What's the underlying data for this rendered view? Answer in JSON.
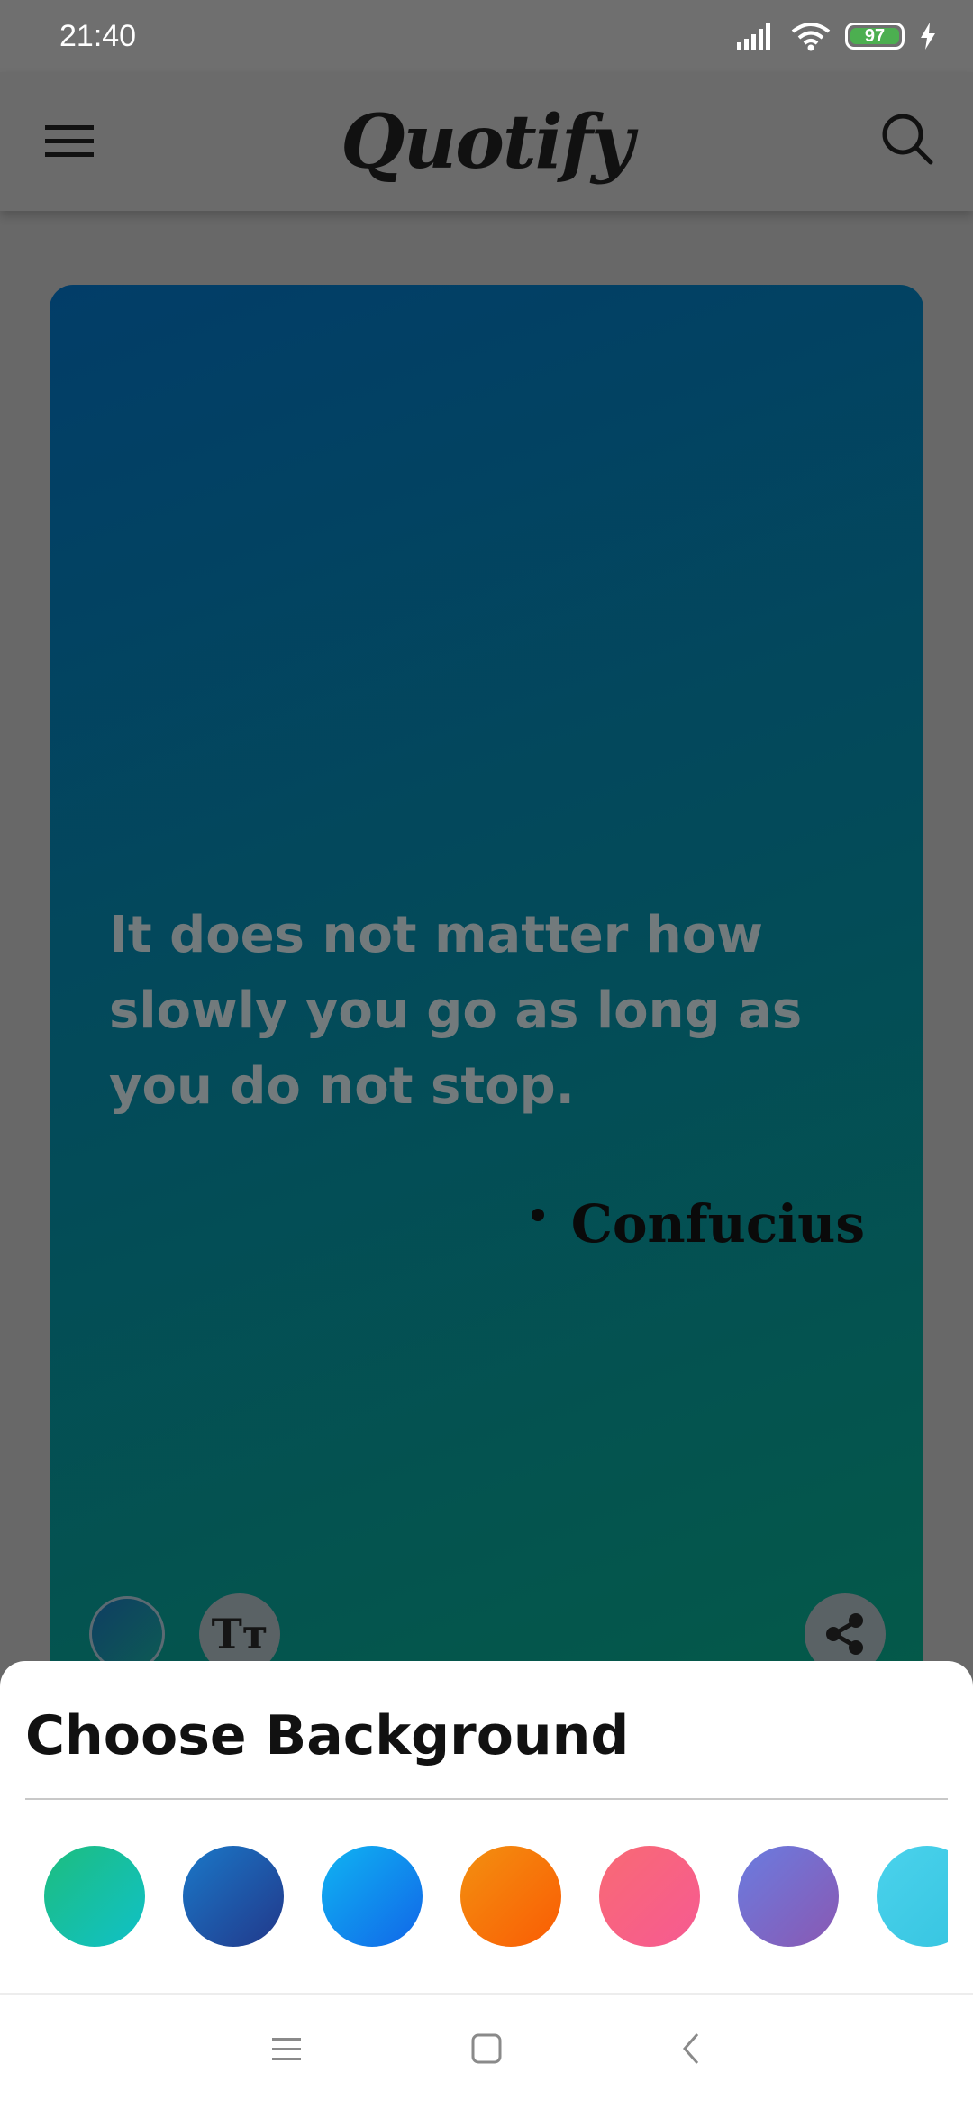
{
  "status_bar": {
    "time": "21:40",
    "battery_level": "97",
    "icons": [
      "signal-icon",
      "wifi-icon",
      "battery-icon",
      "charging-icon"
    ]
  },
  "header": {
    "app_name": "Quotify",
    "menu_icon": "hamburger-menu-icon",
    "search_icon": "search-icon"
  },
  "quote": {
    "text": "It does not matter how slowly you go as long as you do not stop.",
    "author": "Confucius",
    "text_color": "#727a7c",
    "author_color": "#0a0a0a"
  },
  "card_actions": {
    "background_icon": "background-color-icon",
    "font_label": "Tт",
    "share_icon": "share-icon"
  },
  "bottom_sheet": {
    "title": "Choose Background",
    "swatches": [
      {
        "name": "green-teal",
        "from": "#1dbd7e",
        "to": "#10c1c8"
      },
      {
        "name": "blue-navy",
        "from": "#1a78c8",
        "to": "#22388a"
      },
      {
        "name": "sky-blue",
        "from": "#10b4f2",
        "to": "#1166e8"
      },
      {
        "name": "orange",
        "from": "#f39010",
        "to": "#fa5c04"
      },
      {
        "name": "coral-pink",
        "from": "#f96a74",
        "to": "#f65a92"
      },
      {
        "name": "purple",
        "from": "#6a7ce0",
        "to": "#8a58b2"
      },
      {
        "name": "cyan",
        "from": "#4ad2ec",
        "to": "#36c4e0"
      }
    ]
  },
  "nav_bar": {
    "icons": [
      "recents-icon",
      "home-icon",
      "back-icon"
    ]
  }
}
